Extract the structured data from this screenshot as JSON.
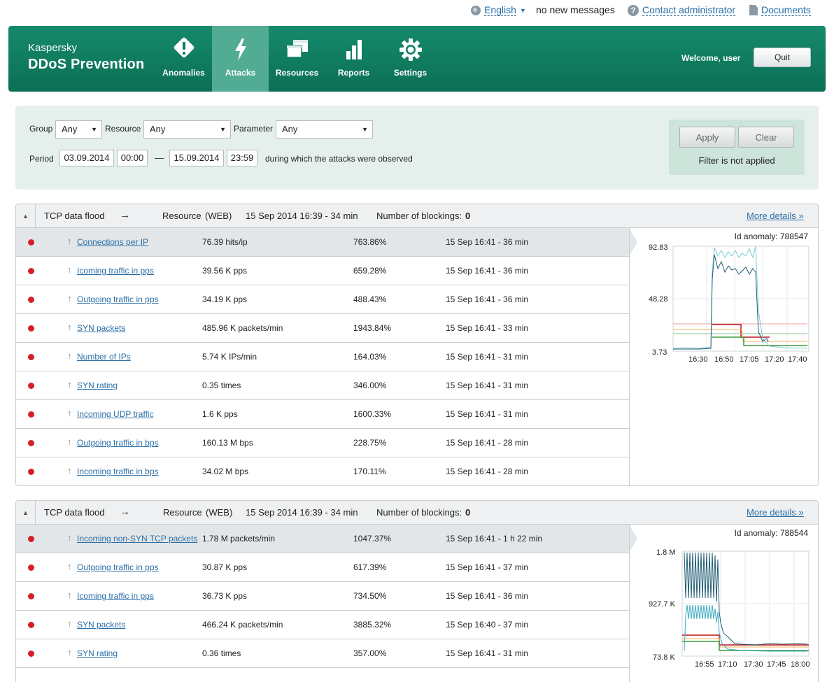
{
  "topbar": {
    "language": "English",
    "messages": "no new messages",
    "contact": "Contact administrator",
    "documents": "Documents"
  },
  "header": {
    "brand_line1": "Kaspersky",
    "brand_line2": "DDoS Prevention",
    "tabs": [
      {
        "label": "Anomalies",
        "icon": "warning-icon"
      },
      {
        "label": "Attacks",
        "icon": "lightning-icon",
        "active": true
      },
      {
        "label": "Resources",
        "icon": "windows-icon"
      },
      {
        "label": "Reports",
        "icon": "bar-chart-icon"
      },
      {
        "label": "Settings",
        "icon": "gear-icon"
      }
    ],
    "welcome": "Welcome, user",
    "quit_label": "Quit",
    "color": "#0f7d60",
    "active_tab_color": "#52ac94"
  },
  "filter": {
    "group_label": "Group",
    "group_value": "Any",
    "resource_label": "Resource",
    "resource_value": "Any",
    "parameter_label": "Parameter",
    "parameter_value": "Any",
    "period_label": "Period",
    "date_from": "03.09.2014",
    "time_from": "00:00",
    "dash": "—",
    "date_to": "15.09.2014",
    "time_to": "23:59",
    "period_note": "during which the attacks were observed",
    "apply_label": "Apply",
    "clear_label": "Clear",
    "status": "Filter is not applied"
  },
  "attacks": [
    {
      "type": "TCP data flood",
      "arrow": "→",
      "resource_label": "Resource",
      "resource": "(WEB)",
      "start": "15 Sep 2014  16:39 -  34 min",
      "blockings_label": "Number of blockings:",
      "blockings": "0",
      "more": "More details »",
      "anomaly_id": "Id anomaly: 788547",
      "rows": [
        {
          "name": "Connections per IP",
          "value": "76.39 hits/ip",
          "percent": "763.86%",
          "time": "15 Sep  16:41 - 36 min"
        },
        {
          "name": "Icoming traffic in pps",
          "value": "39.56 K pps",
          "percent": "659.28%",
          "time": "15 Sep  16:41 - 36 min"
        },
        {
          "name": "Outgoing traffic in pps",
          "value": "34.19 K pps",
          "percent": "488.43%",
          "time": "15 Sep  16:41 - 36 min"
        },
        {
          "name": "SYN packets",
          "value": "485.96 K packets/min",
          "percent": "1943.84%",
          "time": "15 Sep  16:41 - 33 min"
        },
        {
          "name": "Number of IPs",
          "value": "5.74 K IPs/min",
          "percent": "164.03%",
          "time": "15 Sep  16:41 - 31 min"
        },
        {
          "name": "SYN rating",
          "value": "0.35 times",
          "percent": "346.00%",
          "time": "15 Sep  16:41 - 31 min"
        },
        {
          "name": "Incoming UDP traffic",
          "value": "1.6 K pps",
          "percent": "1600.33%",
          "time": "15 Sep  16:41 - 31 min"
        },
        {
          "name": "Outgoing traffic in bps",
          "value": "160.13 M bps",
          "percent": "228.75%",
          "time": "15 Sep  16:41 - 28 min"
        },
        {
          "name": "Incoming traffic in bps",
          "value": "34.02 M bps",
          "percent": "170.11%",
          "time": "15 Sep  16:41 - 28 min"
        }
      ],
      "chart": {
        "y_ticks": [
          "92.83",
          "48.28",
          "3.73"
        ],
        "x_ticks": [
          "16:30",
          "16:50",
          "17:05",
          "17:20",
          "17:40"
        ]
      }
    },
    {
      "type": "TCP data flood",
      "arrow": "→",
      "resource_label": "Resource",
      "resource": "(WEB)",
      "start": "15 Sep 2014  16:39 -  34 min",
      "blockings_label": "Number of blockings:",
      "blockings": "0",
      "more": "More details »",
      "anomaly_id": "Id anomaly: 788544",
      "rows": [
        {
          "name": "Incoming non-SYN TCP packets",
          "value": "1.78 M packets/min",
          "percent": "1047.37%",
          "time": "15 Sep  16:41 - 1 h 22 min"
        },
        {
          "name": "Outgoing traffic in pps",
          "value": "30.87 K pps",
          "percent": "617.39%",
          "time": "15 Sep  16:41 - 37 min"
        },
        {
          "name": "Icoming traffic in pps",
          "value": "36.73 K pps",
          "percent": "734.50%",
          "time": "15 Sep  16:41 - 36 min"
        },
        {
          "name": "SYN packets",
          "value": "466.24 K packets/min",
          "percent": "3885.32%",
          "time": "15 Sep  16:40 - 37 min"
        },
        {
          "name": "SYN rating",
          "value": "0.36 times",
          "percent": "357.00%",
          "time": "15 Sep  16:41 - 31 min"
        }
      ],
      "chart": {
        "y_ticks": [
          "1.8 M",
          "927.7 K",
          "73.8 K"
        ],
        "x_ticks": [
          "16:55",
          "17:10",
          "17:30",
          "17:45",
          "18:00"
        ]
      }
    }
  ]
}
